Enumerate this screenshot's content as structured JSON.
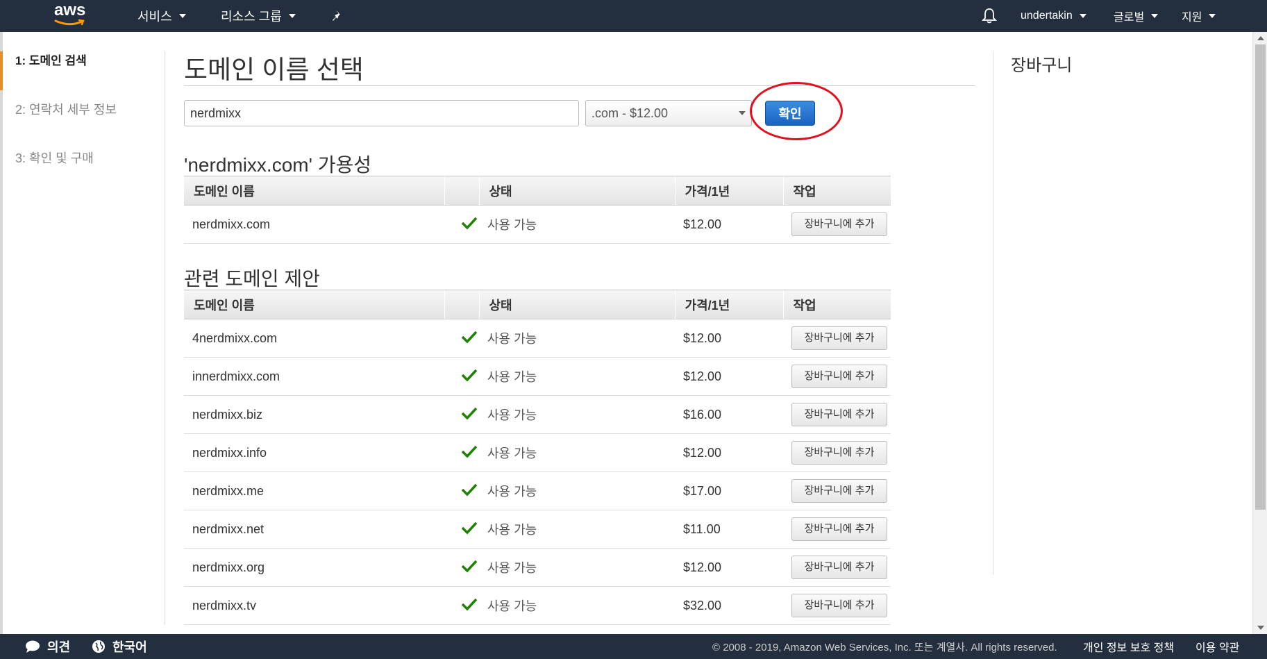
{
  "topnav": {
    "logo": "aws",
    "services": "서비스",
    "resource_groups": "리소스 그룹",
    "username": "undertakin",
    "region": "글로벌",
    "support": "지원"
  },
  "steps": [
    {
      "label": "1: 도메인 검색"
    },
    {
      "label": "2: 연락처 세부 정보"
    },
    {
      "label": "3: 확인 및 구매"
    }
  ],
  "main": {
    "title": "도메인 이름 선택",
    "search_value": "nerdmixx",
    "tld_selected": ".com - $12.00",
    "confirm_label": "확인",
    "availability_title": "'nerdmixx.com' 가용성",
    "suggest_title": "관련 도메인 제안"
  },
  "table_headers": {
    "name": "도메인 이름",
    "status": "상태",
    "price": "가격/1년",
    "action": "작업"
  },
  "available": [
    {
      "name": "nerdmixx.com",
      "status": "사용 가능",
      "price": "$12.00",
      "action": "장바구니에 추가"
    }
  ],
  "suggestions": [
    {
      "name": "4nerdmixx.com",
      "status": "사용 가능",
      "price": "$12.00",
      "action": "장바구니에 추가"
    },
    {
      "name": "innerdmixx.com",
      "status": "사용 가능",
      "price": "$12.00",
      "action": "장바구니에 추가"
    },
    {
      "name": "nerdmixx.biz",
      "status": "사용 가능",
      "price": "$16.00",
      "action": "장바구니에 추가"
    },
    {
      "name": "nerdmixx.info",
      "status": "사용 가능",
      "price": "$12.00",
      "action": "장바구니에 추가"
    },
    {
      "name": "nerdmixx.me",
      "status": "사용 가능",
      "price": "$17.00",
      "action": "장바구니에 추가"
    },
    {
      "name": "nerdmixx.net",
      "status": "사용 가능",
      "price": "$11.00",
      "action": "장바구니에 추가"
    },
    {
      "name": "nerdmixx.org",
      "status": "사용 가능",
      "price": "$12.00",
      "action": "장바구니에 추가"
    },
    {
      "name": "nerdmixx.tv",
      "status": "사용 가능",
      "price": "$32.00",
      "action": "장바구니에 추가"
    }
  ],
  "cart": {
    "title": "장바구니"
  },
  "footer": {
    "feedback": "의견",
    "language": "한국어",
    "copyright": "© 2008 - 2019, Amazon Web Services, Inc. 또는 계열사. All rights reserved.",
    "privacy": "개인 정보 보호 정책",
    "terms": "이용 약관"
  },
  "colors": {
    "nav_bg": "#232f3e",
    "primary_button": "#1a63c2",
    "check": "#1d8102",
    "highlight_circle": "#e0101d"
  }
}
